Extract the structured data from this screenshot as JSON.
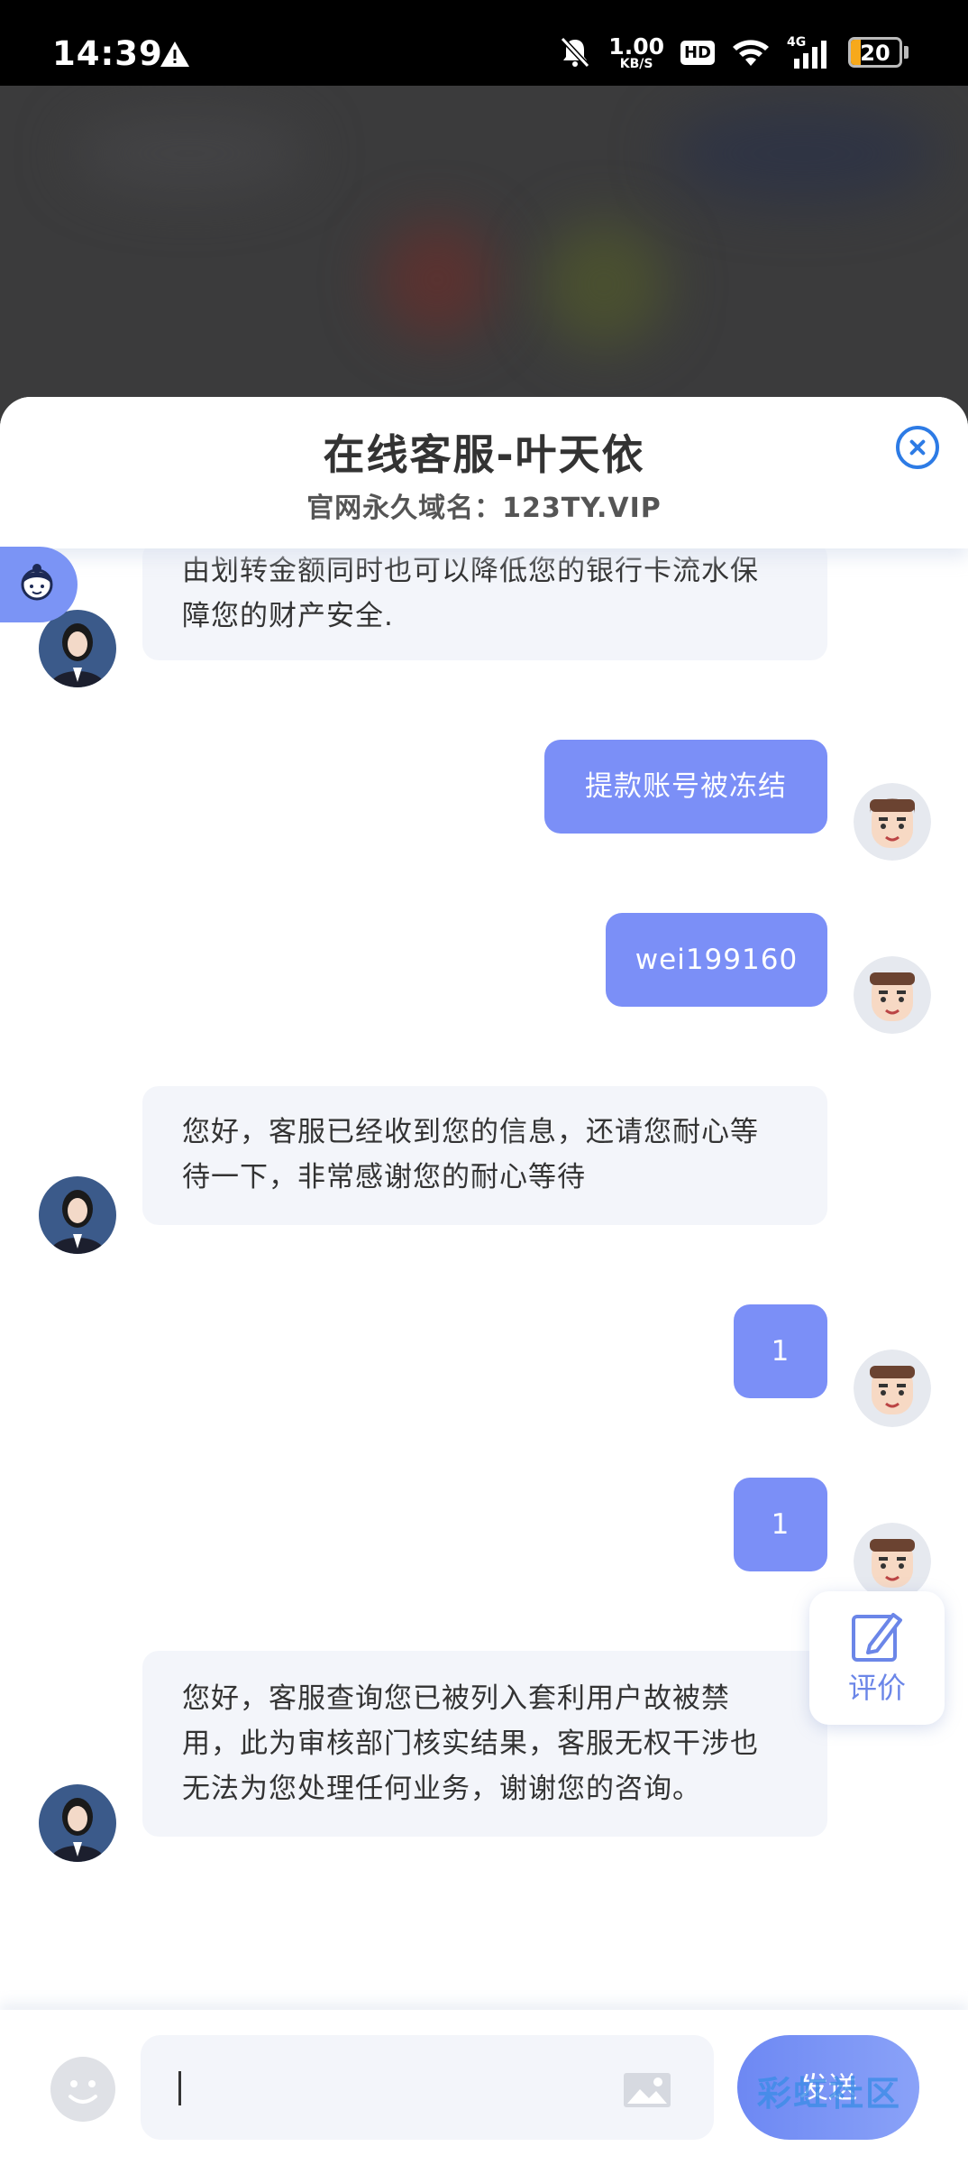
{
  "status_bar": {
    "time": "14:39",
    "net_speed_value": "1.00",
    "net_speed_unit": "KB/S",
    "hd": "HD",
    "network": "4G",
    "battery": "20",
    "battery_level": 0.2,
    "battery_color": "#f7a91b"
  },
  "header": {
    "title": "在线客服-叶天依",
    "subtitle": "官网永久域名：123TY.VIP"
  },
  "messages": [
    {
      "from": "agent",
      "text_lines": [
        "由划转金额同时也可以降低您的银行卡流水保",
        "障您的财产安全."
      ]
    },
    {
      "from": "user",
      "text": "提款账号被冻结"
    },
    {
      "from": "user",
      "text": "wei199160"
    },
    {
      "from": "agent",
      "text_lines": [
        "您好，客服已经收到您的信息，还请您耐心等",
        "待一下，非常感谢您的耐心等待"
      ]
    },
    {
      "from": "user",
      "text": "1"
    },
    {
      "from": "user",
      "text": "1"
    },
    {
      "from": "agent",
      "text_lines": [
        "您好，客服查询您已被列入套利用户故被禁",
        "用，此为审核部门核实结果，客服无权干涉也",
        "无法为您处理任何业务，谢谢您的咨询。"
      ]
    }
  ],
  "rate_button": {
    "label": "评价"
  },
  "input": {
    "value": "",
    "send_label": "发送"
  },
  "watermark": "彩虹社区",
  "colors": {
    "accent": "#7b8ff7",
    "close": "#2d7be5",
    "agent_bubble": "#f3f5fa"
  }
}
